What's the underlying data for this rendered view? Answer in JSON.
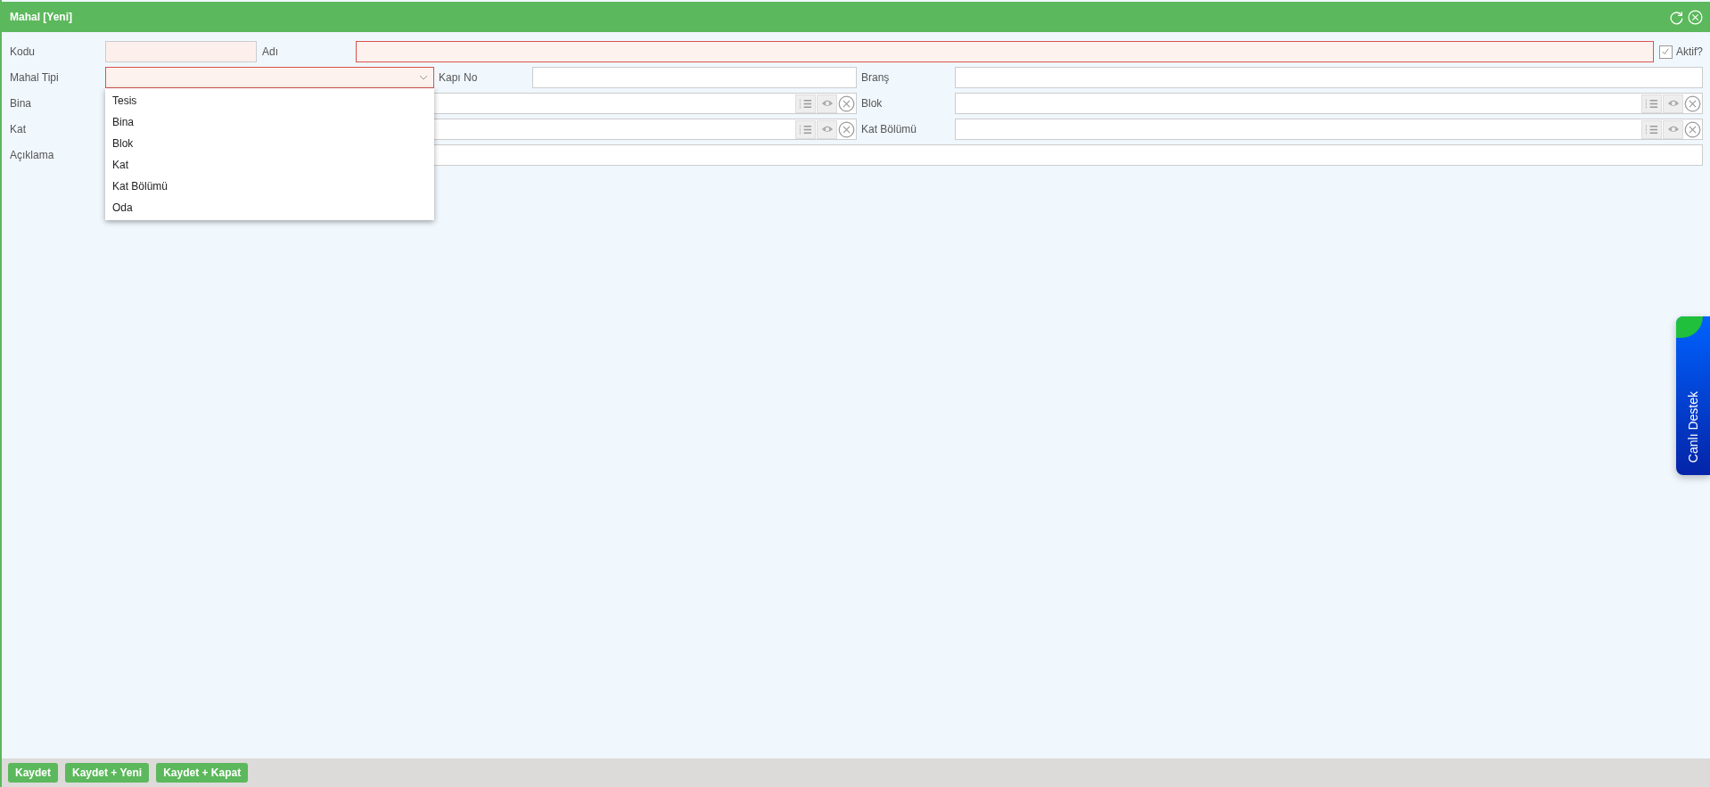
{
  "window": {
    "title": "Mahal [Yeni]"
  },
  "top_row": {
    "code": {
      "label": "Kodu",
      "disabled": true
    },
    "name": {
      "label": "Adı",
      "required": true
    },
    "active": {
      "label": "Aktif?",
      "checked": true
    }
  },
  "rows": [
    [
      {
        "label": "Mahal Tipi",
        "kind": "select",
        "required": true,
        "expanded": true,
        "options": [
          "Tesis",
          "Bina",
          "Blok",
          "Kat",
          "Kat Bölümü",
          "Oda"
        ]
      },
      {
        "label": "Kapı No",
        "kind": "text",
        "required": false
      },
      {
        "label": "Branş",
        "kind": "text",
        "required": false
      }
    ],
    [
      {
        "label": "Bina",
        "kind": "lookup",
        "required": false
      },
      {
        "label": "Blok",
        "kind": "lookup",
        "required": false
      }
    ],
    [
      {
        "label": "Kat",
        "kind": "lookup",
        "required": false
      },
      {
        "label": "Kat Bölümü",
        "kind": "lookup",
        "required": false
      }
    ],
    [
      {
        "label": "Açıklama",
        "kind": "text",
        "required": false
      }
    ]
  ],
  "buttons": [
    "Kaydet",
    "Kaydet + Yeni",
    "Kaydet + Kapat"
  ],
  "live_support": {
    "label": "Canlı Destek"
  }
}
